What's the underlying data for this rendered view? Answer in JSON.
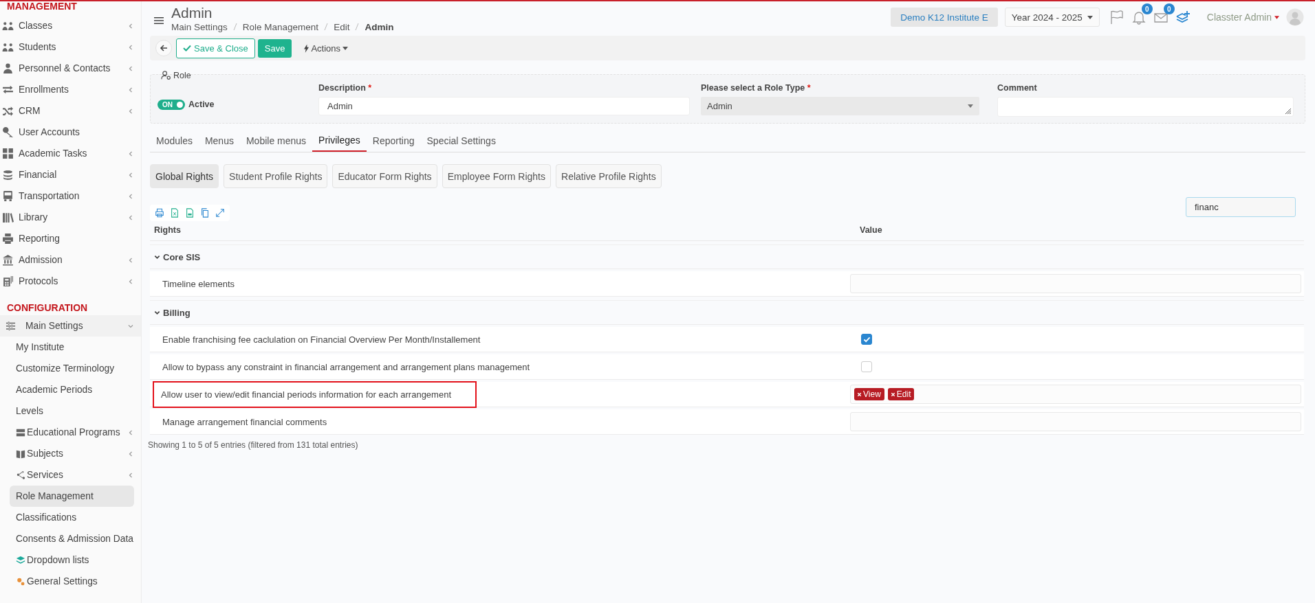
{
  "sidebar": {
    "sections": [
      {
        "title": "MANAGEMENT",
        "items": [
          {
            "label": "Classes",
            "has_submenu": true,
            "selected": false
          },
          {
            "label": "Students",
            "has_submenu": true,
            "selected": false
          },
          {
            "label": "Personnel & Contacts",
            "has_submenu": true,
            "selected": false
          },
          {
            "label": "Enrollments",
            "has_submenu": true,
            "selected": false
          },
          {
            "label": "CRM",
            "has_submenu": true,
            "selected": false
          },
          {
            "label": "User Accounts",
            "has_submenu": false,
            "selected": false
          },
          {
            "label": "Academic Tasks",
            "has_submenu": true,
            "selected": false
          },
          {
            "label": "Financial",
            "has_submenu": true,
            "selected": false
          },
          {
            "label": "Transportation",
            "has_submenu": true,
            "selected": false
          },
          {
            "label": "Library",
            "has_submenu": true,
            "selected": false
          },
          {
            "label": "Reporting",
            "has_submenu": false,
            "selected": false
          },
          {
            "label": "Admission",
            "has_submenu": true,
            "selected": false
          },
          {
            "label": "Protocols",
            "has_submenu": true,
            "selected": false
          }
        ]
      },
      {
        "title": "CONFIGURATION",
        "items": [
          {
            "label": "Main Settings",
            "has_submenu": true,
            "expanded": true,
            "selected": false,
            "children": [
              {
                "label": "My Institute",
                "has_submenu": false,
                "selected": false
              },
              {
                "label": "Customize Terminology",
                "has_submenu": false,
                "selected": false
              },
              {
                "label": "Academic Periods",
                "has_submenu": false,
                "selected": false
              },
              {
                "label": "Levels",
                "has_submenu": false,
                "selected": false
              },
              {
                "label": "Educational Programs",
                "has_submenu": true,
                "selected": false
              },
              {
                "label": "Subjects",
                "has_submenu": true,
                "selected": false
              },
              {
                "label": "Services",
                "has_submenu": true,
                "selected": false
              },
              {
                "label": "Role Management",
                "has_submenu": false,
                "selected": true
              },
              {
                "label": "Classifications",
                "has_submenu": false,
                "selected": false
              },
              {
                "label": "Consents & Admission Data",
                "has_submenu": false,
                "selected": false
              },
              {
                "label": "Dropdown lists",
                "has_submenu": false,
                "selected": false
              },
              {
                "label": "General Settings",
                "has_submenu": false,
                "selected": false
              }
            ]
          }
        ]
      }
    ]
  },
  "header": {
    "title": "Admin",
    "breadcrumb": [
      {
        "label": "Main Settings",
        "current": false
      },
      {
        "label": "Role Management",
        "current": false
      },
      {
        "label": "Edit",
        "current": false
      },
      {
        "label": "Admin",
        "current": true
      }
    ],
    "institute": "Demo K12 Institute E",
    "year": "Year 2024 - 2025",
    "notifications": "0",
    "messages": "0",
    "user": "Classter Admin"
  },
  "toolbar": {
    "save_close": "Save & Close",
    "save": "Save",
    "actions": "Actions"
  },
  "role": {
    "legend": "Role",
    "toggle": {
      "label": "ON",
      "on": true
    },
    "active_label": "Active",
    "description": {
      "label": "Description",
      "required_mark": "*",
      "value": "Admin"
    },
    "role_type": {
      "label": "Please select a Role Type",
      "required_mark": "*",
      "value": "Admin"
    },
    "comment": {
      "label": "Comment"
    }
  },
  "tabs": [
    {
      "label": "Modules",
      "selected": false
    },
    {
      "label": "Menus",
      "selected": false
    },
    {
      "label": "Mobile menus",
      "selected": false
    },
    {
      "label": "Privileges",
      "selected": true
    },
    {
      "label": "Reporting",
      "selected": false
    },
    {
      "label": "Special Settings",
      "selected": false
    }
  ],
  "subtabs": [
    {
      "label": "Global Rights",
      "selected": true
    },
    {
      "label": "Student Profile Rights",
      "selected": false
    },
    {
      "label": "Educator Form Rights",
      "selected": false
    },
    {
      "label": "Employee Form Rights",
      "selected": false
    },
    {
      "label": "Relative Profile Rights",
      "selected": false
    }
  ],
  "search": {
    "value": "financ"
  },
  "table": {
    "columns": [
      "Rights",
      "Value"
    ],
    "groups": [
      {
        "name": "Core SIS",
        "expanded": true,
        "rows": [
          {
            "label": "Timeline elements",
            "kind": "field",
            "highlighted": false
          }
        ]
      },
      {
        "name": "Billing",
        "expanded": true,
        "rows": [
          {
            "label": "Enable franchising fee caclulation on Financial Overview Per Month/Installement",
            "kind": "checkbox",
            "checked": true,
            "highlighted": false
          },
          {
            "label": "Allow to bypass any constraint in financial arrangement and arrangement plans management",
            "kind": "checkbox",
            "checked": false,
            "highlighted": false
          },
          {
            "label": "Allow user to view/edit financial periods information for each arrangement",
            "kind": "tags",
            "tags": [
              "View",
              "Edit"
            ],
            "highlighted": true
          },
          {
            "label": "Manage arrangement financial comments",
            "kind": "field",
            "highlighted": false
          }
        ]
      }
    ]
  },
  "footer": "Showing 1 to 5 of 5 entries (filtered from 131 total entries)"
}
